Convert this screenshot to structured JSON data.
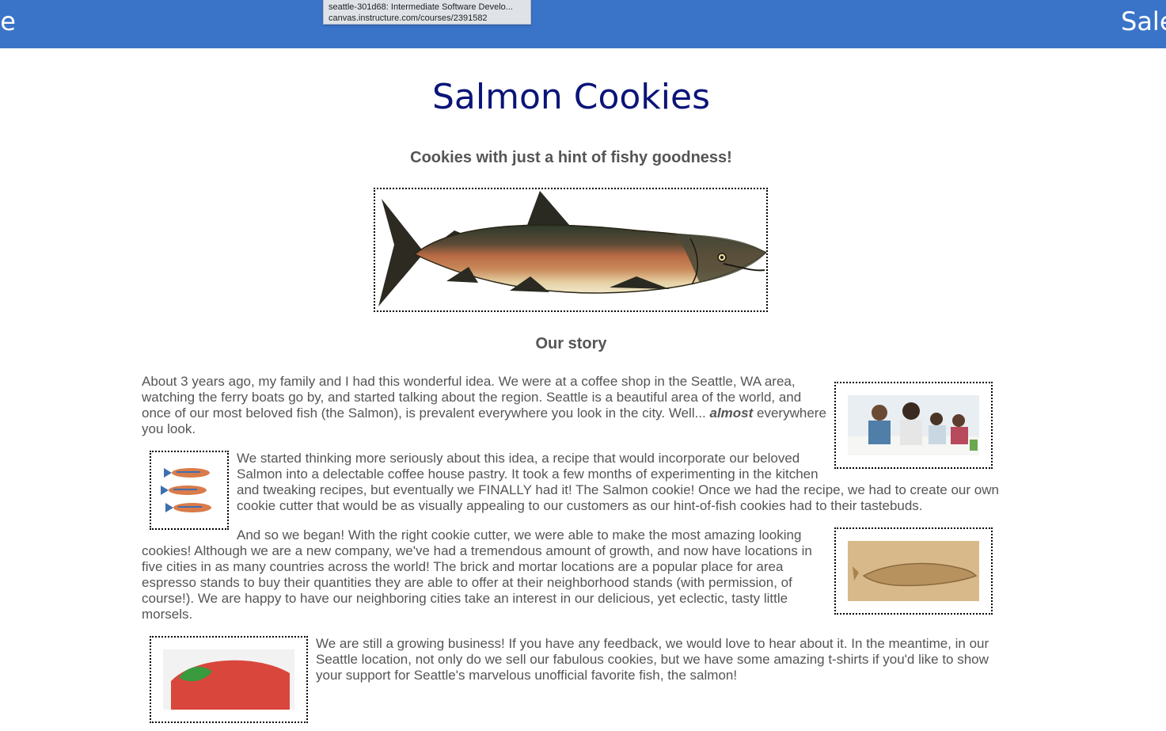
{
  "topbar": {
    "left_label": "ne",
    "right_label": "Sale"
  },
  "tooltip": {
    "title": "seattle-301d68: Intermediate Software Develo...",
    "url": "canvas.instructure.com/courses/2391582"
  },
  "page": {
    "title": "Salmon Cookies",
    "tagline": "Cookies with just a hint of fishy goodness!",
    "section_title": "Our story"
  },
  "story": {
    "p1_before": "About 3 years ago, my family and I had this wonderful idea. We were at a coffee shop in the Seattle, WA area, watching the ferry boats go by, and started talking about the region. Seattle is a beautiful area of the world, and once of our most beloved fish (the Salmon), is prevalent everywhere you look in the city. Well... ",
    "p1_emphasis": "almost",
    "p1_after": " everywhere you look.",
    "p2": "We started thinking more seriously about this idea, a recipe that would incorporate our beloved Salmon into a delectable coffee house pastry. It took a few months of experimenting in the kitchen and tweaking recipes, but eventually we FINALLY had it! The Salmon cookie! Once we had the recipe, we had to create our own cookie cutter that would be as visually appealing to our customers as our hint-of-fish cookies had to their tastebuds.",
    "p3": "And so we began! With the right cookie cutter, we were able to make the most amazing looking cookies! Although we are a new company, we've had a tremendous amount of growth, and now have locations in five cities in as many countries across the world! The brick and mortar locations are a popular place for area espresso stands to buy their quantities they are able to offer at their neighborhood stands (with permission, of course!). We are happy to have our neighboring cities take an interest in our delicious, yet eclectic, tasty little morsels.",
    "p4": "We are still a growing business! If you have any feedback, we would love to hear about it. In the meantime, in our Seattle location, not only do we sell our fabulous cookies, but we have some amazing t-shirts if you'd like to show your support for Seattle's marvelous unofficial favorite fish, the salmon!"
  },
  "colors": {
    "topbar": "#3a74c9",
    "title": "#0b1478",
    "body_text": "#555555"
  }
}
